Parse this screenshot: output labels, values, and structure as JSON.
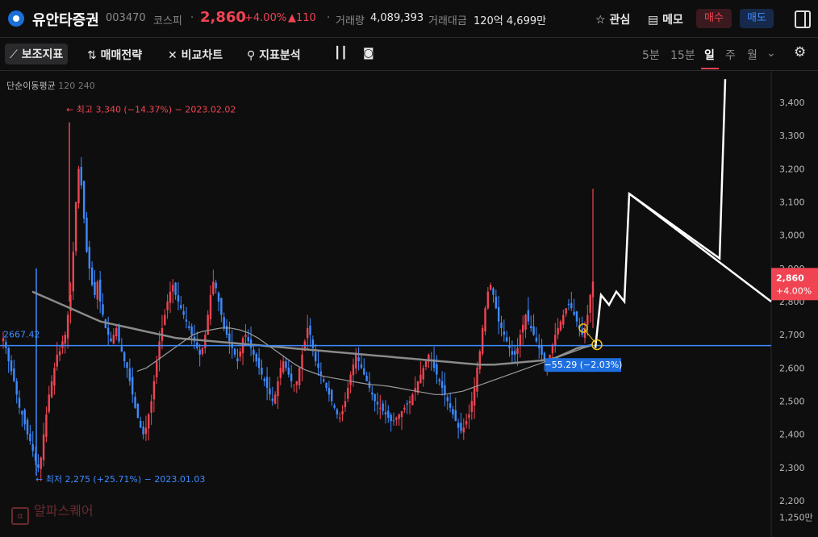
{
  "header": {
    "stock_name": "유안타증권",
    "code": "003470",
    "market": "코스피",
    "price": "2,860",
    "change_pct": "+4.00%",
    "change_abs": "▲110",
    "volume_label": "거래량",
    "volume": "4,089,393",
    "amount_label": "거래대금",
    "amount": "120억 4,699만",
    "watch_label": "관심",
    "memo_label": "메모",
    "buy_label": "매수",
    "sell_label": "매도"
  },
  "toolbar": {
    "tools": [
      "보조지표",
      "매매전략",
      "비교차트",
      "지표분석"
    ],
    "periods": [
      "5분",
      "15분",
      "일",
      "주",
      "월"
    ],
    "selected_period": "일"
  },
  "indicator_label": {
    "name": "단순이동평균",
    "p1": "120",
    "p2": "240"
  },
  "watermark": "알파스퀘어",
  "colors": {
    "up": "#f04452",
    "down": "#3d8bff",
    "hline": "#3d8bff",
    "drawing": "#ffffff"
  },
  "chart_data": {
    "type": "candlestick",
    "ylim": [
      2250,
      3470
    ],
    "y_ticks": [
      "1,250만",
      "2,200",
      "2,300",
      "2,400",
      "2,500",
      "2,600",
      "2,700",
      "2,800",
      "2,900",
      "3,000",
      "3,100",
      "3,200",
      "3,300",
      "3,400"
    ],
    "y_tick_values": [
      2150,
      2200,
      2300,
      2400,
      2500,
      2600,
      2700,
      2800,
      2900,
      3000,
      3100,
      3200,
      3300,
      3400
    ],
    "current_price": {
      "label": "2,860",
      "change": "+4.00%",
      "value": 2860
    },
    "horizontal_line": {
      "value": 2667.42,
      "label": "2667.42"
    },
    "annotations": {
      "high": "최고 3,340 (−14.37%) − 2023.02.02",
      "high_value": 3340,
      "low": "최저 2,275 (+25.71%) − 2023.01.03",
      "low_value": 2275,
      "measure": "−55.29 (−2.03%)"
    },
    "series_close": [
      2690,
      2660,
      2620,
      2590,
      2560,
      2520,
      2480,
      2460,
      2430,
      2400,
      2380,
      2350,
      2320,
      2300,
      2330,
      2400,
      2460,
      2520,
      2560,
      2600,
      2640,
      2650,
      2680,
      2700,
      2760,
      2820,
      2950,
      3100,
      3200,
      3150,
      3050,
      2950,
      2900,
      2850,
      2820,
      2860,
      2800,
      2760,
      2720,
      2700,
      2680,
      2700,
      2720,
      2680,
      2650,
      2620,
      2600,
      2560,
      2520,
      2480,
      2450,
      2420,
      2400,
      2420,
      2460,
      2500,
      2560,
      2620,
      2680,
      2720,
      2760,
      2800,
      2830,
      2850,
      2820,
      2800,
      2780,
      2760,
      2740,
      2720,
      2700,
      2680,
      2660,
      2640,
      2660,
      2700,
      2760,
      2820,
      2860,
      2840,
      2800,
      2760,
      2720,
      2700,
      2680,
      2660,
      2640,
      2620,
      2650,
      2690,
      2700,
      2680,
      2660,
      2640,
      2620,
      2600,
      2580,
      2560,
      2540,
      2520,
      2500,
      2520,
      2560,
      2600,
      2620,
      2600,
      2580,
      2560,
      2550,
      2560,
      2600,
      2640,
      2680,
      2720,
      2700,
      2660,
      2620,
      2600,
      2580,
      2560,
      2540,
      2520,
      2500,
      2480,
      2460,
      2450,
      2470,
      2500,
      2540,
      2580,
      2610,
      2640,
      2620,
      2600,
      2580,
      2560,
      2540,
      2520,
      2500,
      2490,
      2480,
      2470,
      2460,
      2450,
      2440,
      2440,
      2450,
      2460,
      2470,
      2480,
      2490,
      2500,
      2520,
      2540,
      2560,
      2580,
      2600,
      2620,
      2640,
      2620,
      2600,
      2580,
      2560,
      2540,
      2520,
      2500,
      2480,
      2460,
      2440,
      2420,
      2410,
      2420,
      2440,
      2460,
      2500,
      2540,
      2600,
      2650,
      2720,
      2780,
      2830,
      2850,
      2820,
      2780,
      2740,
      2720,
      2700,
      2680,
      2660,
      2640,
      2640,
      2660,
      2700,
      2730,
      2760,
      2740,
      2720,
      2700,
      2680,
      2660,
      2640,
      2620,
      2620,
      2640,
      2670,
      2700,
      2720,
      2740,
      2760,
      2780,
      2790,
      2780,
      2760,
      2740,
      2720,
      2700,
      2720,
      2760,
      2820,
      2860
    ],
    "ma120": [
      2830,
      2820,
      2810,
      2800,
      2790,
      2780,
      2770,
      2760,
      2750,
      2740,
      2735,
      2730,
      2725,
      2720,
      2715,
      2710,
      2705,
      2700,
      2695,
      2690,
      2688,
      2686,
      2684,
      2682,
      2680,
      2678,
      2676,
      2674,
      2672,
      2670,
      2668,
      2666,
      2664,
      2662,
      2660,
      2658,
      2656,
      2654,
      2652,
      2650,
      2648,
      2646,
      2644,
      2642,
      2640,
      2638,
      2636,
      2634,
      2632,
      2630,
      2628,
      2626,
      2624,
      2622,
      2620,
      2618,
      2616,
      2614,
      2612,
      2610,
      2610,
      2610,
      2612,
      2614,
      2616,
      2618,
      2620,
      2622,
      2625,
      2630,
      2640,
      2650,
      2660,
      2665,
      2670
    ],
    "ma240": [
      2590,
      2600,
      2620,
      2640,
      2660,
      2680,
      2700,
      2710,
      2715,
      2720,
      2720,
      2715,
      2705,
      2690,
      2670,
      2650,
      2630,
      2610,
      2595,
      2585,
      2575,
      2570,
      2565,
      2560,
      2555,
      2550,
      2548,
      2545,
      2540,
      2535,
      2530,
      2525,
      2520,
      2520,
      2525,
      2530,
      2540,
      2550,
      2560,
      2570,
      2580,
      2590,
      2600,
      2610,
      2620,
      2630,
      2640,
      2650,
      2660,
      2668
    ],
    "drawing_path": [
      [
        2660,
        "a"
      ],
      [
        2820,
        "b"
      ],
      [
        2790,
        "c"
      ],
      [
        2830,
        "d"
      ],
      [
        2800,
        "e"
      ],
      [
        3125,
        "f"
      ],
      [
        2930,
        "g"
      ],
      [
        3470,
        "h"
      ]
    ],
    "drawing_line2": [
      [
        2930,
        "g"
      ],
      [
        2810,
        "i"
      ]
    ]
  }
}
